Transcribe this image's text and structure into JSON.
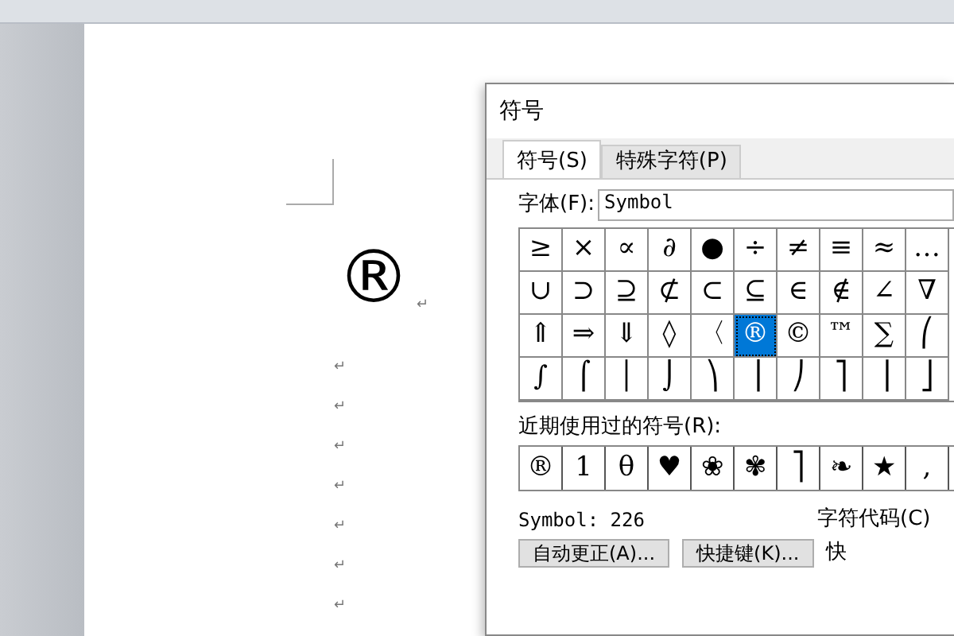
{
  "document": {
    "symbol": "®",
    "symbol_mark": "↵",
    "empty_paragraph_marks": [
      "↵",
      "↵",
      "↵",
      "↵",
      "↵",
      "↵",
      "↵"
    ]
  },
  "dialog": {
    "title": "符号",
    "tabs": [
      {
        "label": "符号(S)",
        "selected": true
      },
      {
        "label": "特殊字符(P)",
        "selected": false
      }
    ],
    "font": {
      "label": "字体(F):",
      "value": "Symbol"
    },
    "grid": [
      [
        {
          "char": "≥",
          "selected": false
        },
        {
          "char": "×",
          "selected": false
        },
        {
          "char": "∝",
          "selected": false
        },
        {
          "char": "∂",
          "selected": false
        },
        {
          "char": "●",
          "selected": false
        },
        {
          "char": "÷",
          "selected": false
        },
        {
          "char": "≠",
          "selected": false
        },
        {
          "char": "≡",
          "selected": false
        },
        {
          "char": "≈",
          "selected": false
        },
        {
          "char": "…",
          "selected": false
        }
      ],
      [
        {
          "char": "∪",
          "selected": false
        },
        {
          "char": "⊃",
          "selected": false
        },
        {
          "char": "⊇",
          "selected": false
        },
        {
          "char": "⊄",
          "selected": false
        },
        {
          "char": "⊂",
          "selected": false
        },
        {
          "char": "⊆",
          "selected": false
        },
        {
          "char": "∈",
          "selected": false
        },
        {
          "char": "∉",
          "selected": false
        },
        {
          "char": "∠",
          "selected": false
        },
        {
          "char": "∇",
          "selected": false
        }
      ],
      [
        {
          "char": "⇑",
          "selected": false
        },
        {
          "char": "⇒",
          "selected": false
        },
        {
          "char": "⇓",
          "selected": false
        },
        {
          "char": "◊",
          "selected": false
        },
        {
          "char": "〈",
          "selected": false
        },
        {
          "char": "®",
          "selected": true
        },
        {
          "char": "©",
          "selected": false
        },
        {
          "char": "™",
          "selected": false
        },
        {
          "char": "∑",
          "selected": false
        },
        {
          "char": "⎛",
          "selected": false
        }
      ],
      [
        {
          "char": "∫",
          "selected": false
        },
        {
          "char": "⌠",
          "selected": false
        },
        {
          "char": "│",
          "selected": false
        },
        {
          "char": "⌡",
          "selected": false
        },
        {
          "char": "⎞",
          "selected": false
        },
        {
          "char": "⎟",
          "selected": false
        },
        {
          "char": "⎠",
          "selected": false
        },
        {
          "char": "⎤",
          "selected": false
        },
        {
          "char": "⎥",
          "selected": false
        },
        {
          "char": "⎦",
          "selected": false
        }
      ]
    ],
    "recent_label": "近期使用过的符号(R):",
    "recent": [
      "®",
      "1",
      "θ",
      "♥",
      "❀",
      "✾",
      "⎤",
      "❧",
      "★",
      ","
    ],
    "char_info": "Symbol: 226",
    "char_code_label": "字符代码(C)",
    "buttons": [
      "自动更正(A)...",
      "快捷键(K)..."
    ],
    "cut_label": "快"
  }
}
